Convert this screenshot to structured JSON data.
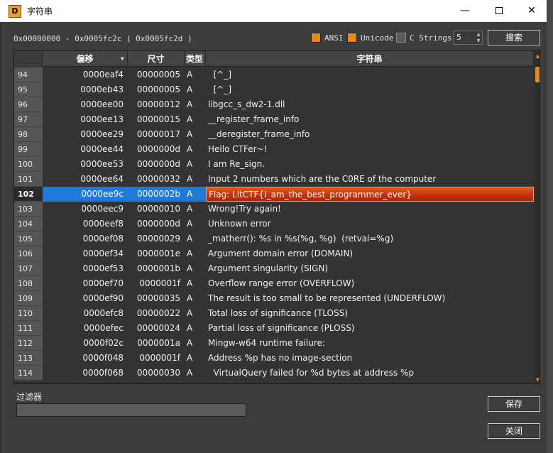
{
  "window": {
    "icon_label": "D",
    "title": "字符串",
    "minimize": "—",
    "close": "✕"
  },
  "range_text": "0x00000000 - 0x0005fc2c ( 0x0005fc2d )",
  "options": {
    "ansi": "ANSI",
    "unicode": "Unicode",
    "c_strings": "C Strings",
    "min_length": "5"
  },
  "buttons": {
    "search": "搜索",
    "save": "保存",
    "close": "关闭"
  },
  "table": {
    "headers": {
      "index": "",
      "offset": "偏移",
      "size": "尺寸",
      "type": "类型",
      "string": "字符串"
    },
    "selected_index": "102",
    "rows": [
      {
        "idx": "94",
        "off": "0000eaf4",
        "size": "00000005",
        "type": "A",
        "str": "  [^_]"
      },
      {
        "idx": "95",
        "off": "0000eb43",
        "size": "00000005",
        "type": "A",
        "str": "  [^_]"
      },
      {
        "idx": "96",
        "off": "0000ee00",
        "size": "00000012",
        "type": "A",
        "str": "libgcc_s_dw2-1.dll"
      },
      {
        "idx": "97",
        "off": "0000ee13",
        "size": "00000015",
        "type": "A",
        "str": "__register_frame_info"
      },
      {
        "idx": "98",
        "off": "0000ee29",
        "size": "00000017",
        "type": "A",
        "str": "__deregister_frame_info"
      },
      {
        "idx": "99",
        "off": "0000ee44",
        "size": "0000000d",
        "type": "A",
        "str": "Hello CTFer~!"
      },
      {
        "idx": "100",
        "off": "0000ee53",
        "size": "0000000d",
        "type": "A",
        "str": "I am Re_sign."
      },
      {
        "idx": "101",
        "off": "0000ee64",
        "size": "00000032",
        "type": "A",
        "str": "Input 2 numbers which are the C0RE of the computer"
      },
      {
        "idx": "102",
        "off": "0000ee9c",
        "size": "0000002b",
        "type": "A",
        "str": "Flag: LitCTF{I_am_the_best_programmer_ever}"
      },
      {
        "idx": "103",
        "off": "0000eec9",
        "size": "00000010",
        "type": "A",
        "str": "Wrong!Try again!"
      },
      {
        "idx": "104",
        "off": "0000eef8",
        "size": "0000000d",
        "type": "A",
        "str": "Unknown error"
      },
      {
        "idx": "105",
        "off": "0000ef08",
        "size": "00000029",
        "type": "A",
        "str": "_matherr(): %s in %s(%g, %g)  (retval=%g)"
      },
      {
        "idx": "106",
        "off": "0000ef34",
        "size": "0000001e",
        "type": "A",
        "str": "Argument domain error (DOMAIN)"
      },
      {
        "idx": "107",
        "off": "0000ef53",
        "size": "0000001b",
        "type": "A",
        "str": "Argument singularity (SIGN)"
      },
      {
        "idx": "108",
        "off": "0000ef70",
        "size": "0000001f",
        "type": "A",
        "str": "Overflow range error (OVERFLOW)"
      },
      {
        "idx": "109",
        "off": "0000ef90",
        "size": "00000035",
        "type": "A",
        "str": "The result is too small to be represented (UNDERFLOW)"
      },
      {
        "idx": "110",
        "off": "0000efc8",
        "size": "00000022",
        "type": "A",
        "str": "Total loss of significance (TLOSS)"
      },
      {
        "idx": "111",
        "off": "0000efec",
        "size": "00000024",
        "type": "A",
        "str": "Partial loss of significance (PLOSS)"
      },
      {
        "idx": "112",
        "off": "0000f02c",
        "size": "0000001a",
        "type": "A",
        "str": "Mingw-w64 runtime failure:"
      },
      {
        "idx": "113",
        "off": "0000f048",
        "size": "0000001f",
        "type": "A",
        "str": "Address %p has no image-section"
      },
      {
        "idx": "114",
        "off": "0000f068",
        "size": "00000030",
        "type": "A",
        "str": "  VirtualQuery failed for %d bytes at address %p"
      }
    ]
  },
  "filter": {
    "label": "过滤器",
    "value": ""
  },
  "colors": {
    "accent": "#e48a1c",
    "selection_blue": "#1e7ad8",
    "selection_red": "#c23010"
  }
}
